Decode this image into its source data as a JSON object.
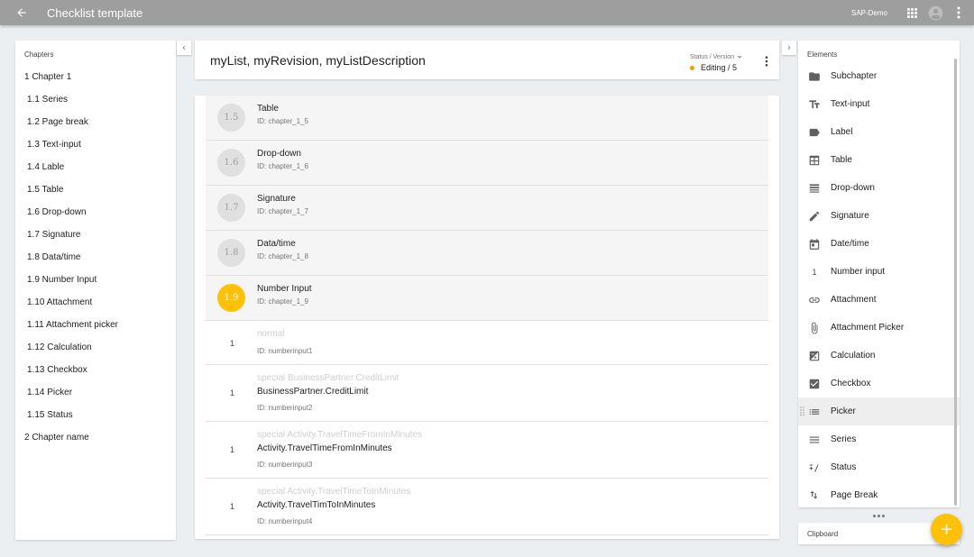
{
  "app_bar": {
    "title": "Checklist template",
    "org": "SAP-Demo",
    "icons": [
      "back-arrow-icon",
      "apps-grid-icon",
      "account-circle-icon",
      "more-vert-icon"
    ]
  },
  "chapters": {
    "header": "Chapters",
    "items": [
      {
        "label": "1 Chapter 1",
        "level": 0
      },
      {
        "label": "1.1 Series",
        "level": 1
      },
      {
        "label": "1.2 Page break",
        "level": 1
      },
      {
        "label": "1.3 Text-input",
        "level": 1
      },
      {
        "label": "1.4 Lable",
        "level": 1
      },
      {
        "label": "1.5 Table",
        "level": 1
      },
      {
        "label": "1.6 Drop-down",
        "level": 1
      },
      {
        "label": "1.7 Signature",
        "level": 1
      },
      {
        "label": "1.8 Data/time",
        "level": 1
      },
      {
        "label": "1.9 Number Input",
        "level": 1
      },
      {
        "label": "1.10 Attachment",
        "level": 1
      },
      {
        "label": "1.11 Attachment picker",
        "level": 1
      },
      {
        "label": "1.12 Calculation",
        "level": 1
      },
      {
        "label": "1.13 Checkbox",
        "level": 1
      },
      {
        "label": "1.14 Picker",
        "level": 1
      },
      {
        "label": "1.15 Status",
        "level": 1
      },
      {
        "label": "2 Chapter name",
        "level": 0
      }
    ]
  },
  "header": {
    "title": "myList, myRevision, myListDescription",
    "status_label": "Status / Version",
    "status_value": "Editing / 5",
    "status_color": "#ff9800"
  },
  "content": {
    "chapter_rows": [
      {
        "number": "1.5",
        "name": "Table",
        "id": "ID: chapter_1_5",
        "active": false
      },
      {
        "number": "1.6",
        "name": "Drop-down",
        "id": "ID: chapter_1_6",
        "active": false
      },
      {
        "number": "1.7",
        "name": "Signature",
        "id": "ID: chapter_1_7",
        "active": false
      },
      {
        "number": "1.8",
        "name": "Data/time",
        "id": "ID: chapter_1_8",
        "active": false
      },
      {
        "number": "1.9",
        "name": "Number Input",
        "id": "ID: chapter_1_9",
        "active": true
      }
    ],
    "number_rows": [
      {
        "icon": "1",
        "special": "normal",
        "name": "",
        "id": "ID: numberinput1"
      },
      {
        "icon": "1",
        "special": "special BusinessPartner.CreditLimit",
        "name": "BusinessPartner.CreditLimit",
        "id": "ID: numberinput2"
      },
      {
        "icon": "1",
        "special": "special Activity.TravelTimeFromInMinutes",
        "name": "Activity.TravelTimeFromInMinutes",
        "id": "ID: numberinput3"
      },
      {
        "icon": "1",
        "special": "special Activity.TravelTimeToInMinutes",
        "name": "Activity.TravelTimToInMinutes",
        "id": "ID: numberinput4"
      }
    ],
    "active_color": "#ffc107"
  },
  "elements": {
    "header": "Elements",
    "items": [
      {
        "label": "Subchapter",
        "icon": "folder-icon"
      },
      {
        "label": "Text-input",
        "icon": "text-fields-icon"
      },
      {
        "label": "Label",
        "icon": "label-icon"
      },
      {
        "label": "Table",
        "icon": "table-grid-icon"
      },
      {
        "label": "Drop-down",
        "icon": "list-lines-icon"
      },
      {
        "label": "Signature",
        "icon": "pencil-icon"
      },
      {
        "label": "Date/time",
        "icon": "calendar-icon"
      },
      {
        "label": "Number input",
        "icon": "number-one-icon",
        "glyph": "1"
      },
      {
        "label": "Attachment",
        "icon": "link-icon"
      },
      {
        "label": "Attachment Picker",
        "icon": "paperclip-icon"
      },
      {
        "label": "Calculation",
        "icon": "calculation-icon"
      },
      {
        "label": "Checkbox",
        "icon": "checkbox-icon"
      },
      {
        "label": "Picker",
        "icon": "list-bullets-icon"
      },
      {
        "label": "Series",
        "icon": "series-lines-icon"
      },
      {
        "label": "Status",
        "icon": "status-icon"
      },
      {
        "label": "Page Break",
        "icon": "page-break-icon"
      }
    ],
    "hover_index": 12
  },
  "clipboard": {
    "header": "Clipboard"
  },
  "fab": {
    "label": "+"
  }
}
